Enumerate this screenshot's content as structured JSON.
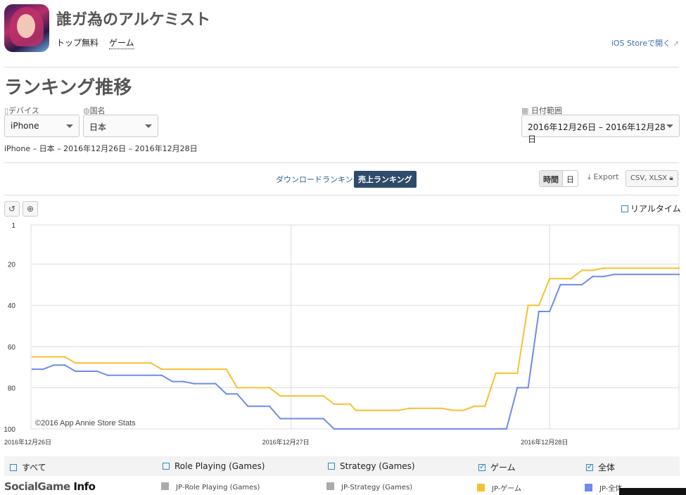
{
  "app": {
    "title": "誰ガ為のアルケミスト",
    "ranking_type": "トップ無料",
    "category": "ゲーム",
    "store_link": "iOS Storeで開く"
  },
  "page": {
    "title": "ランキング推移",
    "summary": "iPhone – 日本 – 2016年12月26日 – 2016年12月28日"
  },
  "filters": {
    "device_label": "デバイス",
    "device_value": "iPhone",
    "country_label": "国名",
    "country_value": "日本",
    "date_label": "日付範囲",
    "date_value": "2016年12月26日 – 2016年12月28日"
  },
  "tabs": {
    "download": "ダウンロードランキング",
    "sales": "売上ランキング"
  },
  "toolbar": {
    "hour": "時間",
    "day": "日",
    "export": "Export",
    "csv": "CSV, XLSX",
    "realtime": "リアルタイム"
  },
  "colors": {
    "game": "#f7c030",
    "overall": "#6f8ce8",
    "grey": "#aaaaaa",
    "accent": "#2e4b69"
  },
  "chart_data": {
    "type": "line",
    "credit": "©2016 App Annie Store Stats",
    "x_tick_labels": [
      "2016年12月26日",
      "2016年12月27日",
      "2016年12月28日"
    ],
    "x_range_hours": [
      0,
      60
    ],
    "y_tick_labels": [
      "1",
      "20",
      "40",
      "60",
      "80",
      "100"
    ],
    "y_ticks": [
      1,
      20,
      40,
      60,
      80,
      100
    ],
    "ylim": [
      1,
      100
    ],
    "y_reversed": true,
    "series": [
      {
        "name": "JP-ゲーム",
        "color": "#f7c030",
        "points": [
          [
            0,
            65
          ],
          [
            3,
            65
          ],
          [
            4,
            68
          ],
          [
            11,
            68
          ],
          [
            12,
            71
          ],
          [
            18,
            71
          ],
          [
            19,
            80
          ],
          [
            22,
            80
          ],
          [
            23,
            84
          ],
          [
            27,
            84
          ],
          [
            28,
            88
          ],
          [
            29.5,
            88
          ],
          [
            30,
            91
          ],
          [
            34,
            91
          ],
          [
            35,
            90
          ],
          [
            38,
            90
          ],
          [
            39,
            91
          ],
          [
            40,
            91
          ],
          [
            41,
            89
          ],
          [
            42,
            89
          ],
          [
            43,
            73
          ],
          [
            45,
            73
          ],
          [
            46,
            40
          ],
          [
            47,
            40
          ],
          [
            48,
            27
          ],
          [
            50,
            27
          ],
          [
            51,
            23
          ],
          [
            52,
            23
          ],
          [
            53,
            22
          ],
          [
            60,
            22
          ]
        ]
      },
      {
        "name": "JP-全体",
        "color": "#6f8ce8",
        "points": [
          [
            0,
            71
          ],
          [
            1,
            71
          ],
          [
            2,
            69
          ],
          [
            3,
            69
          ],
          [
            4,
            72
          ],
          [
            6,
            72
          ],
          [
            7,
            74
          ],
          [
            12,
            74
          ],
          [
            13,
            77
          ],
          [
            14,
            77
          ],
          [
            15,
            78
          ],
          [
            17,
            78
          ],
          [
            18,
            83
          ],
          [
            19,
            83
          ],
          [
            20,
            89
          ],
          [
            22,
            89
          ],
          [
            23,
            95
          ],
          [
            27,
            95
          ],
          [
            28,
            100
          ],
          [
            29.5,
            100
          ],
          [
            44,
            100
          ],
          [
            45,
            80
          ],
          [
            46,
            80
          ],
          [
            47,
            43
          ],
          [
            48,
            43
          ],
          [
            49,
            30
          ],
          [
            51,
            30
          ],
          [
            52,
            26
          ],
          [
            53,
            26
          ],
          [
            54,
            25
          ],
          [
            60,
            25
          ]
        ]
      }
    ]
  },
  "legend": {
    "checks": [
      {
        "label": "すべて",
        "checked": false
      },
      {
        "label": "Role Playing (Games)",
        "checked": false
      },
      {
        "label": "Strategy (Games)",
        "checked": false
      },
      {
        "label": "ゲーム",
        "checked": true
      },
      {
        "label": "全体",
        "checked": true
      }
    ],
    "series": [
      {
        "label": "JP-Role Playing (Games)"
      },
      {
        "label": "JP-Strategy (Games)"
      },
      {
        "label": "JP-ゲーム"
      },
      {
        "label": "JP-全体"
      }
    ]
  },
  "watermark": {
    "social": "SocialGame",
    "info": "Info"
  }
}
